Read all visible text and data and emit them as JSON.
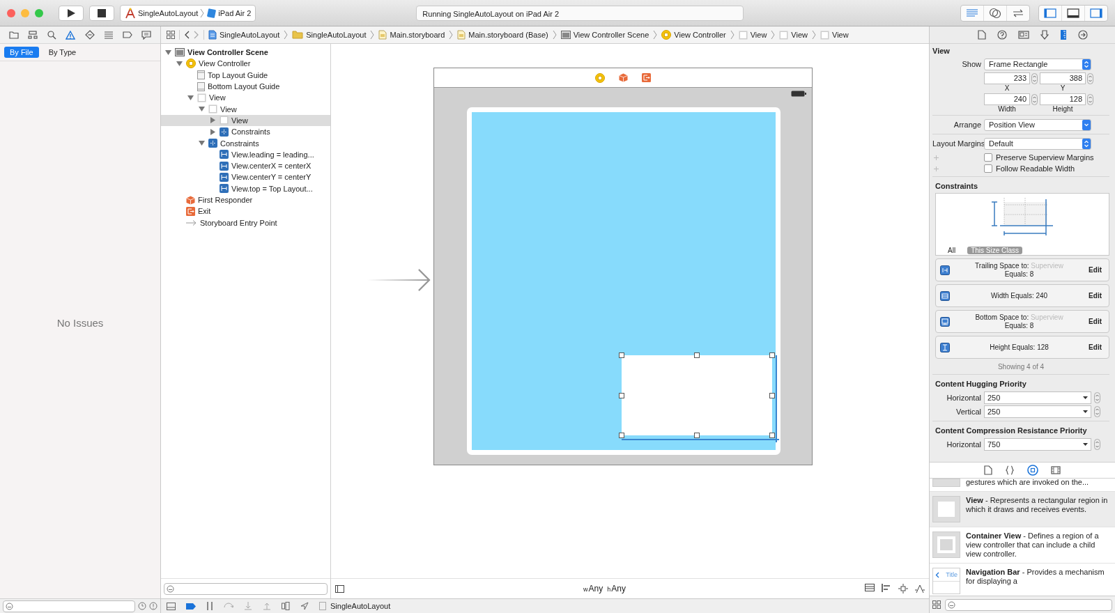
{
  "window": {
    "controls": [
      {
        "color": "#fc605c"
      },
      {
        "color": "#fdbc40"
      },
      {
        "color": "#34c84a"
      }
    ]
  },
  "toolbar": {
    "scheme": {
      "target": "SingleAutoLayout",
      "device": "iPad Air 2"
    },
    "status": "Running SingleAutoLayout on iPad Air 2",
    "editor_modes": [
      {
        "kind": "standard",
        "selected": true
      },
      {
        "kind": "assistant",
        "selected": false
      },
      {
        "kind": "version",
        "selected": false
      }
    ],
    "panels": [
      {
        "kind": "left",
        "on": true
      },
      {
        "kind": "bottom",
        "on": false
      },
      {
        "kind": "right",
        "on": true
      }
    ]
  },
  "navigator": {
    "tabs": [
      {
        "kind": "folder",
        "selected": false
      },
      {
        "kind": "hierarchy",
        "selected": false
      },
      {
        "kind": "search",
        "selected": false
      },
      {
        "kind": "warning",
        "selected": true
      },
      {
        "kind": "diamond",
        "selected": false
      },
      {
        "kind": "list",
        "selected": false
      },
      {
        "kind": "tag",
        "selected": false
      },
      {
        "kind": "speech",
        "selected": false
      }
    ],
    "scopes": [
      {
        "label": "By File",
        "selected": true
      },
      {
        "label": "By Type",
        "selected": false
      }
    ],
    "empty_message": "No Issues"
  },
  "jump_bar": [
    {
      "kind": "project",
      "label": "SingleAutoLayout"
    },
    {
      "kind": "folder",
      "label": "SingleAutoLayout"
    },
    {
      "kind": "storyboard",
      "label": "Main.storyboard"
    },
    {
      "kind": "storyboard",
      "label": "Main.storyboard (Base)"
    },
    {
      "kind": "scene",
      "label": "View Controller Scene"
    },
    {
      "kind": "controller",
      "label": "View Controller"
    },
    {
      "kind": "view",
      "label": "View"
    },
    {
      "kind": "view",
      "label": "View"
    },
    {
      "kind": "view",
      "label": "View"
    }
  ],
  "outline": [
    {
      "kind": "scene",
      "label": "View Controller Scene",
      "expanded": true,
      "selected": false,
      "children": [
        {
          "kind": "controller",
          "label": "View Controller",
          "expanded": true,
          "selected": false,
          "children": [
            {
              "kind": "guide-top",
              "label": "Top Layout Guide",
              "selected": false
            },
            {
              "kind": "guide-bottom",
              "label": "Bottom Layout Guide",
              "selected": false
            },
            {
              "kind": "view",
              "label": "View",
              "expanded": true,
              "selected": false,
              "children": [
                {
                  "kind": "view",
                  "label": "View",
                  "expanded": true,
                  "selected": false,
                  "children": [
                    {
                      "kind": "view",
                      "label": "View",
                      "expanded": false,
                      "selected": true
                    },
                    {
                      "kind": "constraints",
                      "label": "Constraints",
                      "expanded": false,
                      "selected": false
                    }
                  ]
                },
                {
                  "kind": "constraints",
                  "label": "Constraints",
                  "expanded": true,
                  "selected": false,
                  "children": [
                    {
                      "kind": "constraint",
                      "label": "View.leading = leading...",
                      "selected": false
                    },
                    {
                      "kind": "constraint",
                      "label": "View.centerX = centerX",
                      "selected": false
                    },
                    {
                      "kind": "constraint",
                      "label": "View.centerY = centerY",
                      "selected": false
                    },
                    {
                      "kind": "constraint",
                      "label": "View.top = Top Layout...",
                      "selected": false
                    }
                  ]
                }
              ]
            }
          ]
        },
        {
          "kind": "responder",
          "label": "First Responder",
          "selected": false
        },
        {
          "kind": "exit",
          "label": "Exit",
          "selected": false
        },
        {
          "kind": "entry",
          "label": "Storyboard Entry Point",
          "selected": false
        }
      ]
    }
  ],
  "canvas": {
    "size_class": [
      {
        "prefix": "w",
        "value": "Any"
      },
      {
        "prefix": "h",
        "value": "Any"
      }
    ]
  },
  "debug_bar": {
    "breakpoints_on": true,
    "scheme": "SingleAutoLayout"
  },
  "inspector": {
    "tabs": [
      {
        "kind": "document",
        "selected": false
      },
      {
        "kind": "help",
        "selected": false
      },
      {
        "kind": "identity",
        "selected": false
      },
      {
        "kind": "attributes",
        "selected": false
      },
      {
        "kind": "ruler",
        "selected": true
      },
      {
        "kind": "connections",
        "selected": false
      }
    ],
    "title": "View",
    "show": {
      "label": "Show",
      "value": "Frame Rectangle"
    },
    "frame": [
      {
        "value": "233",
        "label": "X"
      },
      {
        "value": "388",
        "label": "Y"
      },
      {
        "value": "240",
        "label": "Width"
      },
      {
        "value": "128",
        "label": "Height"
      }
    ],
    "arrange": {
      "label": "Arrange",
      "value": "Position View"
    },
    "layout_margins": {
      "label": "Layout Margins",
      "value": "Default"
    },
    "options": [
      {
        "label": "Preserve Superview Margins",
        "checked": false
      },
      {
        "label": "Follow Readable Width",
        "checked": false
      }
    ],
    "constraints": {
      "title": "Constraints",
      "filters": [
        {
          "label": "All",
          "selected": false
        },
        {
          "label": "This Size Class",
          "selected": true
        }
      ],
      "items": [
        {
          "kind": "trailing",
          "label": "Trailing Space to:",
          "target": "Superview",
          "detail": "Equals:",
          "value": "8",
          "action": "Edit"
        },
        {
          "kind": "width",
          "label": "Width Equals:",
          "value": "240",
          "action": "Edit"
        },
        {
          "kind": "bottom",
          "label": "Bottom Space to:",
          "target": "Superview",
          "detail": "Equals:",
          "value": "8",
          "action": "Edit"
        },
        {
          "kind": "height",
          "label": "Height Equals:",
          "value": "128",
          "action": "Edit"
        }
      ],
      "footer": "Showing 4 of 4"
    },
    "hugging": {
      "title": "Content Hugging Priority",
      "rows": [
        {
          "label": "Horizontal",
          "value": "250"
        },
        {
          "label": "Vertical",
          "value": "250"
        }
      ]
    },
    "compression": {
      "title": "Content Compression Resistance Priority",
      "rows": [
        {
          "label": "Horizontal",
          "value": "750"
        }
      ]
    }
  },
  "library": {
    "tabs": [
      {
        "kind": "document",
        "selected": false
      },
      {
        "kind": "braces",
        "selected": false
      },
      {
        "kind": "target",
        "selected": true
      },
      {
        "kind": "film",
        "selected": false
      }
    ],
    "items": [
      {
        "kind": "partial",
        "text": "gestures which are invoked on the...",
        "selected": false
      },
      {
        "kind": "view",
        "text": "**View** - Represents a rectangular region in which it draws and receives events.",
        "selected": true
      },
      {
        "kind": "container",
        "text": "**Container View** - Defines a region of a view controller that can include a child view controller.",
        "selected": false
      },
      {
        "kind": "navbar",
        "thumb_label": "Title",
        "text": "**Navigation Bar** - Provides a mechanism for displaying a",
        "selected": false
      }
    ]
  }
}
